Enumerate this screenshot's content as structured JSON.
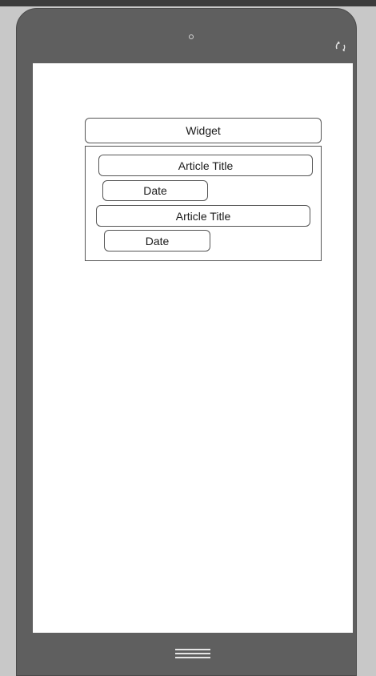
{
  "icons": {
    "camera": "camera-dot-icon",
    "rotate": "rotate-icon",
    "home": "home-menu-icon"
  },
  "colors": {
    "frame": "#5f5f5f",
    "screen": "#ffffff",
    "outline": "#555555",
    "background": "#c8c8c8"
  },
  "widget": {
    "title": "Widget",
    "articles": [
      {
        "title": "Article Title",
        "date": "Date"
      },
      {
        "title": "Article Title",
        "date": "Date"
      }
    ]
  }
}
